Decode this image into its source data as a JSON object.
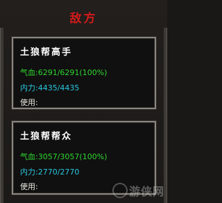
{
  "panel": {
    "title": "敌方"
  },
  "enemies": [
    {
      "name": "土狼帮高手",
      "hp_label": "气血:",
      "hp_value": "6291/6291(100%)",
      "mp_label": "内力:",
      "mp_value": "4435/4435",
      "use_label": "使用:"
    },
    {
      "name": "土狼帮帮众",
      "hp_label": "气血:",
      "hp_value": "3057/3057(100%)",
      "mp_label": "内力:",
      "mp_value": "2770/2770",
      "use_label": "使用:"
    }
  ],
  "watermark": {
    "text": "游侠网"
  },
  "colors": {
    "title": "#d11a1a",
    "hp": "#2ed62e",
    "mp": "#29c7e0",
    "name": "#ffffff",
    "card_border": "#8a8780"
  }
}
